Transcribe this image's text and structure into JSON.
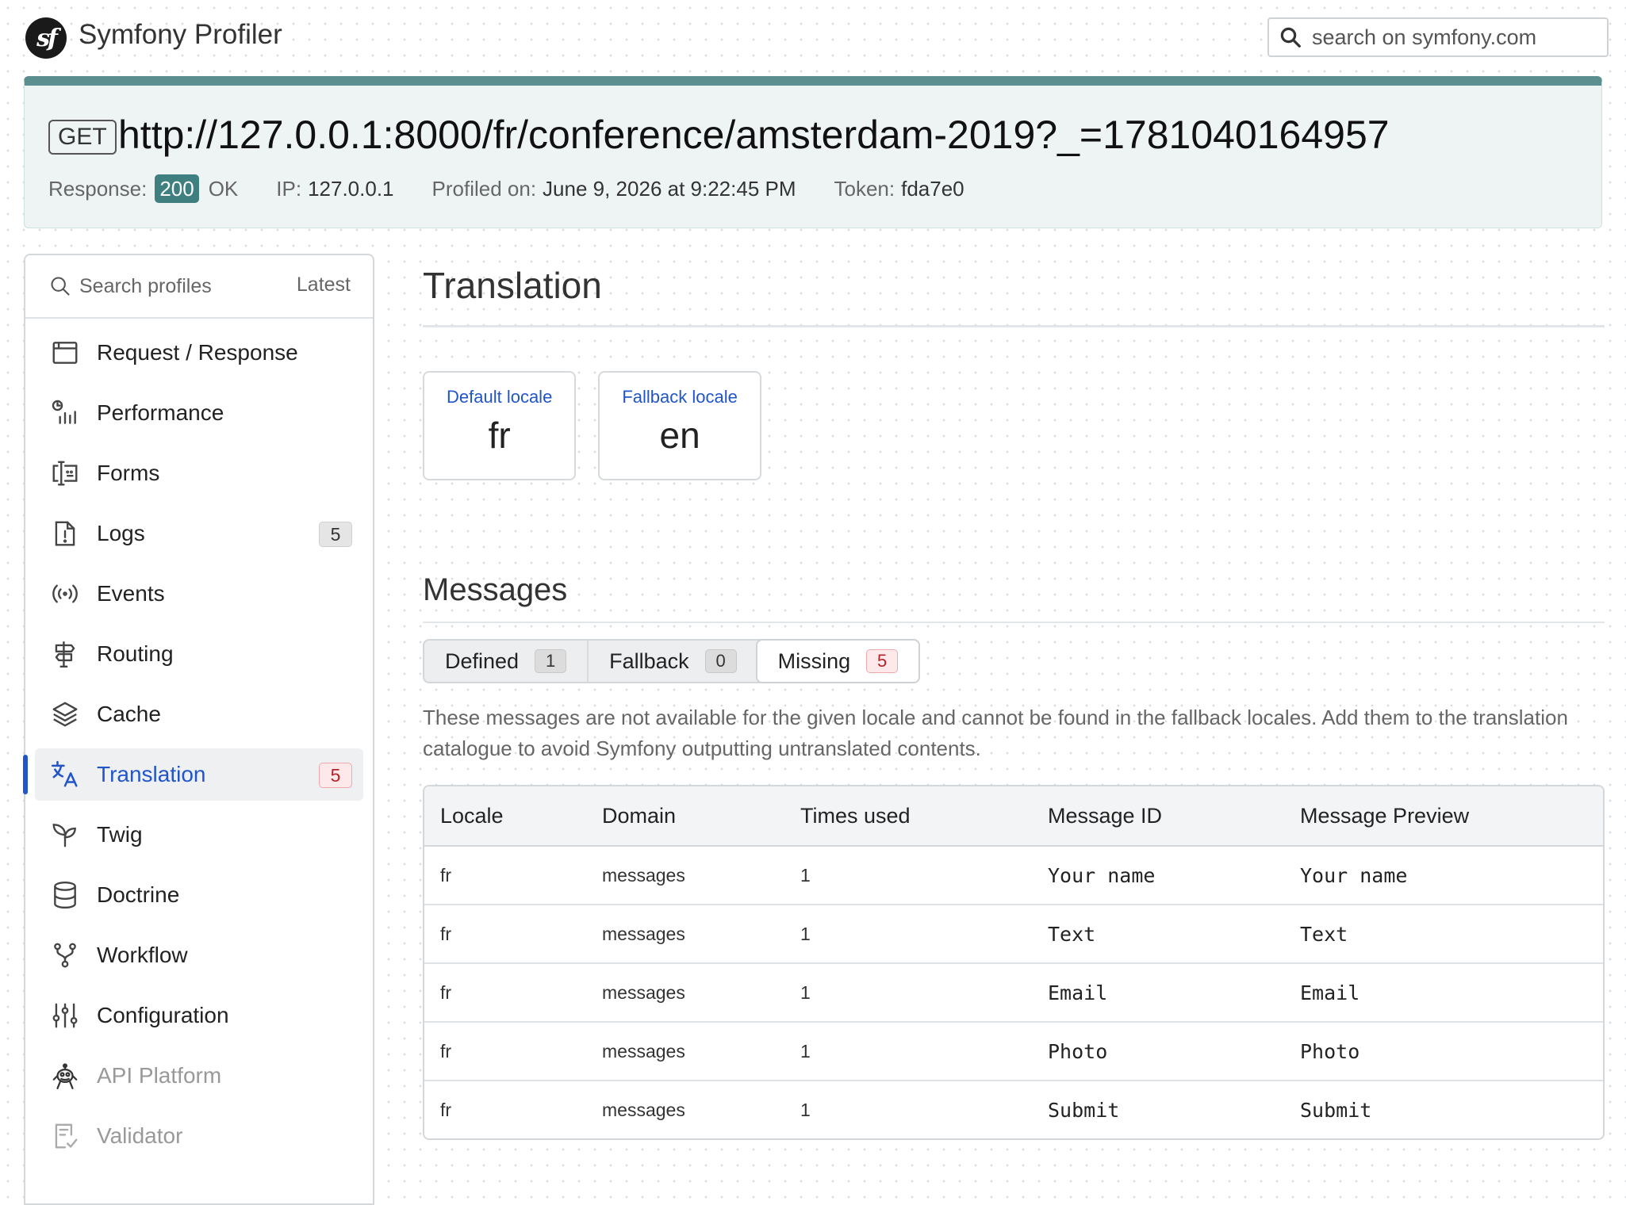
{
  "header": {
    "app_title": "Symfony Profiler",
    "logo_text": "sf",
    "search_placeholder": "search on symfony.com"
  },
  "summary": {
    "method": "GET",
    "url": "http://127.0.0.1:8000/fr/conference/amsterdam-2019?_=1781040164957",
    "response_label": "Response:",
    "status_code": "200",
    "status_text": "OK",
    "ip_label": "IP:",
    "ip": "127.0.0.1",
    "profiled_label": "Profiled on:",
    "profiled_on": "June 9, 2026 at 9:22:45 PM",
    "token_label": "Token:",
    "token": "fda7e0"
  },
  "sidebar": {
    "search_placeholder": "Search profiles",
    "latest_label": "Latest",
    "items": [
      {
        "label": "Request / Response",
        "icon": "request-response-icon"
      },
      {
        "label": "Performance",
        "icon": "performance-icon"
      },
      {
        "label": "Forms",
        "icon": "forms-icon"
      },
      {
        "label": "Logs",
        "icon": "logs-icon",
        "count": "5"
      },
      {
        "label": "Events",
        "icon": "events-icon"
      },
      {
        "label": "Routing",
        "icon": "routing-icon"
      },
      {
        "label": "Cache",
        "icon": "cache-icon"
      },
      {
        "label": "Translation",
        "icon": "translation-icon",
        "count": "5",
        "active": true
      },
      {
        "label": "Twig",
        "icon": "twig-icon"
      },
      {
        "label": "Doctrine",
        "icon": "doctrine-icon"
      },
      {
        "label": "Workflow",
        "icon": "workflow-icon"
      },
      {
        "label": "Configuration",
        "icon": "configuration-icon"
      },
      {
        "label": "API Platform",
        "icon": "api-platform-icon",
        "disabled": true
      },
      {
        "label": "Validator",
        "icon": "validator-icon",
        "disabled": true
      }
    ]
  },
  "main": {
    "title": "Translation",
    "metrics": [
      {
        "label": "Default locale",
        "value": "fr"
      },
      {
        "label": "Fallback locale",
        "value": "en"
      }
    ],
    "messages_title": "Messages",
    "tabs": [
      {
        "label": "Defined",
        "count": "1"
      },
      {
        "label": "Fallback",
        "count": "0"
      },
      {
        "label": "Missing",
        "count": "5",
        "active": true
      }
    ],
    "help_text": "These messages are not available for the given locale and cannot be found in the fallback locales. Add them to the translation catalogue to avoid Symfony outputting untranslated contents.",
    "table": {
      "columns": [
        "Locale",
        "Domain",
        "Times used",
        "Message ID",
        "Message Preview"
      ],
      "rows": [
        [
          "fr",
          "messages",
          "1",
          "Your name",
          "Your name"
        ],
        [
          "fr",
          "messages",
          "1",
          "Text",
          "Text"
        ],
        [
          "fr",
          "messages",
          "1",
          "Email",
          "Email"
        ],
        [
          "fr",
          "messages",
          "1",
          "Photo",
          "Photo"
        ],
        [
          "fr",
          "messages",
          "1",
          "Submit",
          "Submit"
        ]
      ]
    }
  },
  "colors": {
    "accent": "#5b8f8f",
    "status": "#3f7f80",
    "link": "#2155c9",
    "missing_badge": "#b4232c"
  }
}
